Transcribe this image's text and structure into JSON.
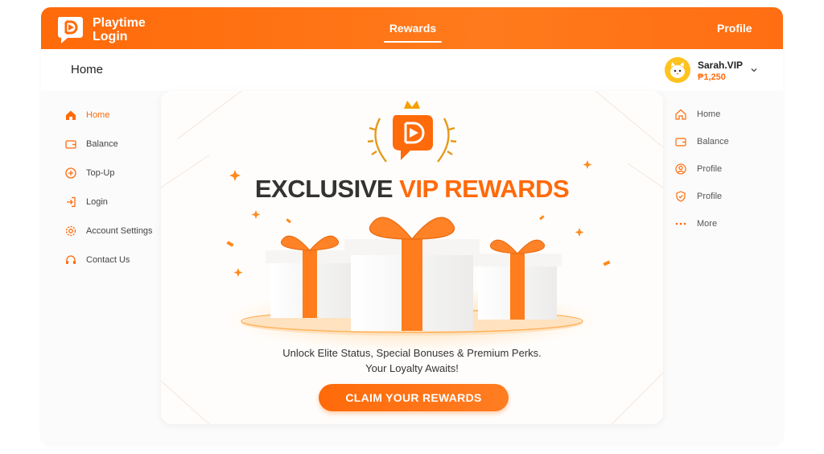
{
  "brand": {
    "line1": "Playtime",
    "line2": "Login",
    "accent": "#ff6a0a"
  },
  "topnav": {
    "rewards": "Rewards",
    "profile": "Profile"
  },
  "page": {
    "title": "Home"
  },
  "user": {
    "name": "Sarah.VIP",
    "balance": "₱1,250"
  },
  "sidebar_left": [
    {
      "label": "Home",
      "icon": "home-icon",
      "active": true
    },
    {
      "label": "Balance",
      "icon": "wallet-icon"
    },
    {
      "label": "Top-Up",
      "icon": "plus-circle-icon"
    },
    {
      "label": "Login",
      "icon": "login-icon"
    },
    {
      "label": "Account Settings",
      "icon": "gear-icon"
    },
    {
      "label": "Contact Us",
      "icon": "headset-icon"
    }
  ],
  "sidebar_right": [
    {
      "label": "Home",
      "icon": "home-icon"
    },
    {
      "label": "Balance",
      "icon": "wallet-icon"
    },
    {
      "label": "Profile",
      "icon": "user-icon"
    },
    {
      "label": "Profile",
      "icon": "shield-icon"
    },
    {
      "label": "More",
      "icon": "more-icon"
    }
  ],
  "banner": {
    "headline_part1": "EXCLUSIVE ",
    "headline_part2": "VIP REWARDS",
    "sub1": "Unlock Elite Status, Special Bonuses & Premium Perks.",
    "sub2": "Your Loyalty Awaits!",
    "cta": "CLAIM YOUR REWARDS"
  }
}
